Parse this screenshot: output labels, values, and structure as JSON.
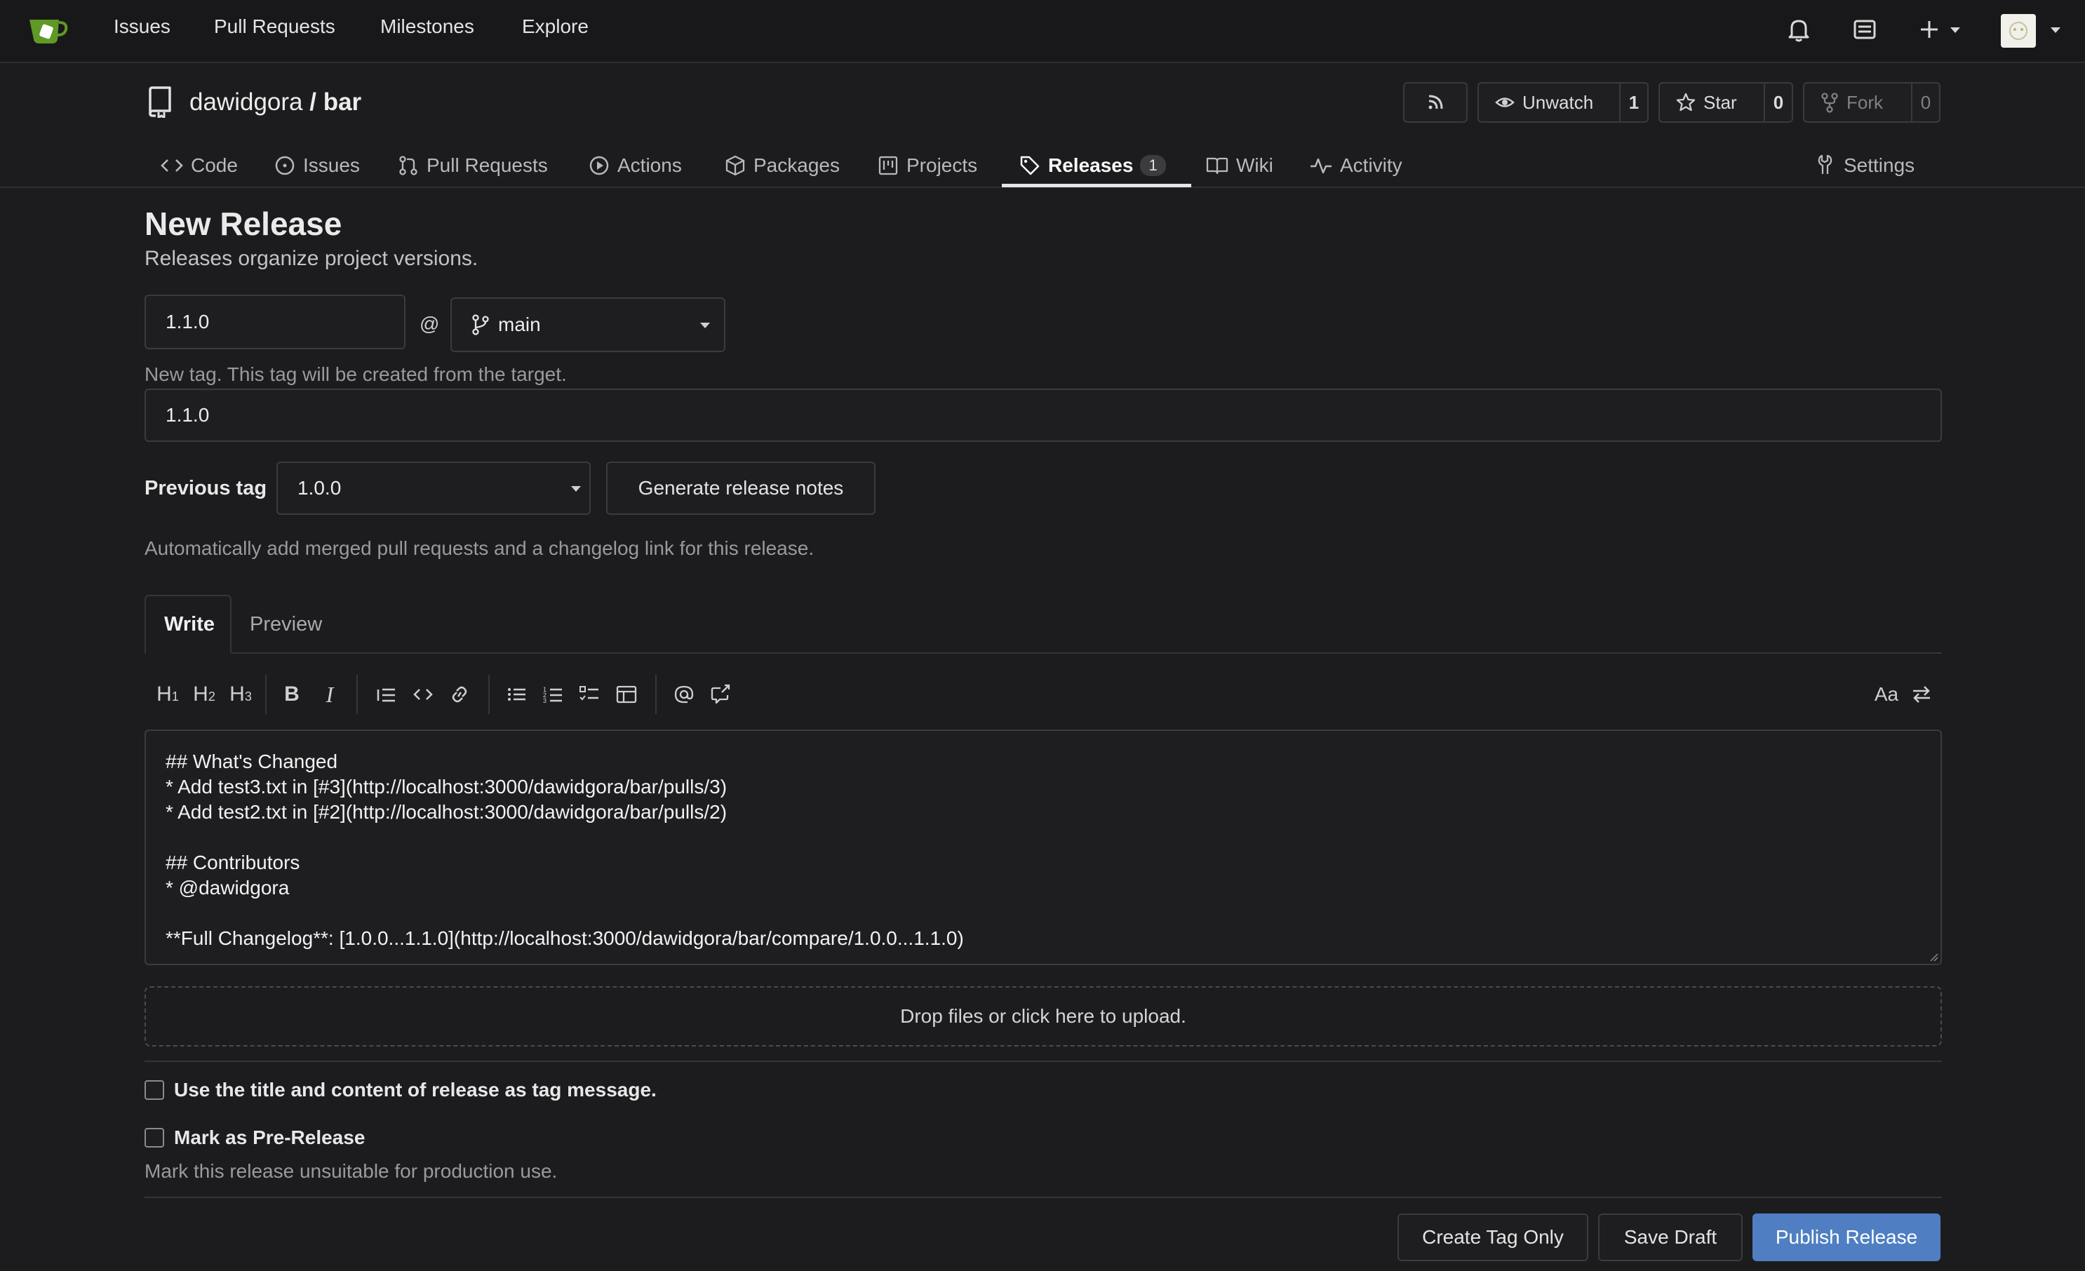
{
  "topnav": {
    "links": [
      "Issues",
      "Pull Requests",
      "Milestones",
      "Explore"
    ]
  },
  "repo": {
    "owner": "dawidgora",
    "separator": "/",
    "name": "bar",
    "unwatch_label": "Unwatch",
    "watch_count": "1",
    "star_label": "Star",
    "star_count": "0",
    "fork_label": "Fork",
    "fork_count": "0"
  },
  "tabs": {
    "code": "Code",
    "issues": "Issues",
    "pulls": "Pull Requests",
    "actions": "Actions",
    "packages": "Packages",
    "projects": "Projects",
    "releases": "Releases",
    "releases_count": "1",
    "wiki": "Wiki",
    "activity": "Activity",
    "settings": "Settings"
  },
  "page": {
    "title": "New Release",
    "subtitle": "Releases organize project versions."
  },
  "form": {
    "tag_value": "1.1.0",
    "at": "@",
    "target_branch": "main",
    "tag_hint": "New tag. This tag will be created from the target.",
    "title_value": "1.1.0",
    "previous_tag_label": "Previous tag",
    "previous_tag_value": "1.0.0",
    "generate_notes_label": "Generate release notes",
    "generate_hint": "Automatically add merged pull requests and a changelog link for this release."
  },
  "editor": {
    "write_tab": "Write",
    "preview_tab": "Preview",
    "content": "## What's Changed\n* Add test3.txt in [#3](http://localhost:3000/dawidgora/bar/pulls/3)\n* Add test2.txt in [#2](http://localhost:3000/dawidgora/bar/pulls/2)\n\n## Contributors\n* @dawidgora\n\n**Full Changelog**: [1.0.0...1.1.0](http://localhost:3000/dawidgora/bar/compare/1.0.0...1.1.0)",
    "font_toggle": "Aa",
    "dropzone": "Drop files or click here to upload."
  },
  "options": {
    "tag_message_label": "Use the title and content of release as tag message.",
    "prerelease_label": "Mark as Pre-Release",
    "prerelease_hint": "Mark this release unsuitable for production use."
  },
  "actions": {
    "create_tag_only": "Create Tag Only",
    "save_draft": "Save Draft",
    "publish": "Publish Release"
  },
  "colors": {
    "primary": "#4f7fc2",
    "background": "#1c1c1e"
  }
}
